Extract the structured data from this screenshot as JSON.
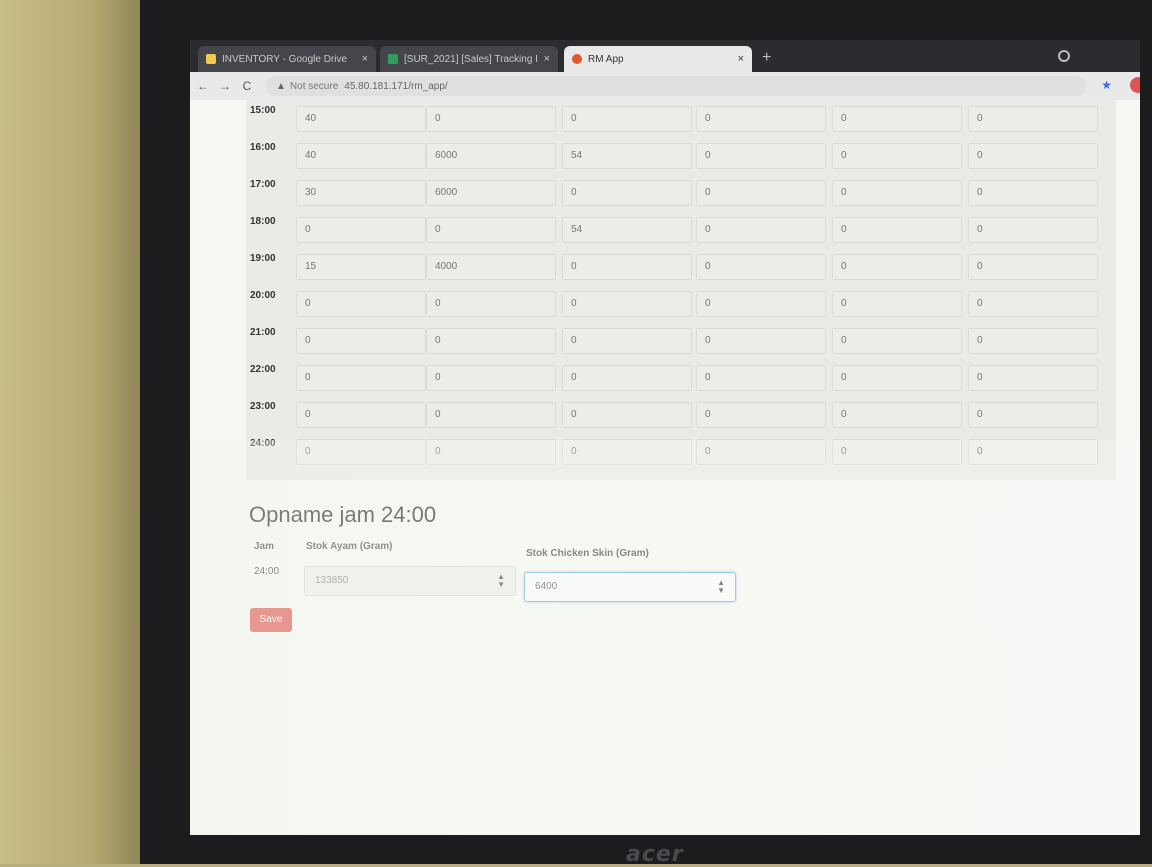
{
  "browser": {
    "tabs": [
      {
        "label": "INVENTORY - Google Drive",
        "active": false,
        "color": "#f2c94c"
      },
      {
        "label": "[SUR_2021] [Sales] Tracking Inven…",
        "active": false,
        "color": "#2e9e5b"
      },
      {
        "label": "RM App",
        "active": true,
        "color": "#e4572e"
      }
    ],
    "close_glyph": "×",
    "new_tab_glyph": "+",
    "back_glyph": "←",
    "forward_glyph": "→",
    "reload_glyph": "C",
    "warning_glyph": "▲",
    "not_secure": "Not secure",
    "url": "45.80.181.171/rm_app/"
  },
  "hourly_table": {
    "rows": [
      {
        "hour": "15:00",
        "values": [
          "40",
          "0",
          "0",
          "0",
          "0",
          "0"
        ]
      },
      {
        "hour": "16:00",
        "values": [
          "40",
          "6000",
          "54",
          "0",
          "0",
          "0"
        ]
      },
      {
        "hour": "17:00",
        "values": [
          "30",
          "6000",
          "0",
          "0",
          "0",
          "0"
        ]
      },
      {
        "hour": "18:00",
        "values": [
          "0",
          "0",
          "54",
          "0",
          "0",
          "0"
        ]
      },
      {
        "hour": "19:00",
        "values": [
          "15",
          "4000",
          "0",
          "0",
          "0",
          "0"
        ]
      },
      {
        "hour": "20:00",
        "values": [
          "0",
          "0",
          "0",
          "0",
          "0",
          "0"
        ]
      },
      {
        "hour": "21:00",
        "values": [
          "0",
          "0",
          "0",
          "0",
          "0",
          "0"
        ]
      },
      {
        "hour": "22:00",
        "values": [
          "0",
          "0",
          "0",
          "0",
          "0",
          "0"
        ]
      },
      {
        "hour": "23:00",
        "values": [
          "0",
          "0",
          "0",
          "0",
          "0",
          "0"
        ]
      },
      {
        "hour": "24:00",
        "values": [
          "0",
          "0",
          "0",
          "0",
          "0",
          "0"
        ]
      }
    ]
  },
  "opname": {
    "title": "Opname jam 24:00",
    "headers": {
      "jam": "Jam",
      "stok_ayam": "Stok Ayam (Gram)",
      "stok_chicken_skin": "Stok Chicken Skin (Gram)"
    },
    "jam_value": "24:00",
    "stok_ayam_value": "133850",
    "stok_chicken_skin_value": "6400",
    "save_label": "Save"
  },
  "monitor": {
    "brand": "acer"
  }
}
